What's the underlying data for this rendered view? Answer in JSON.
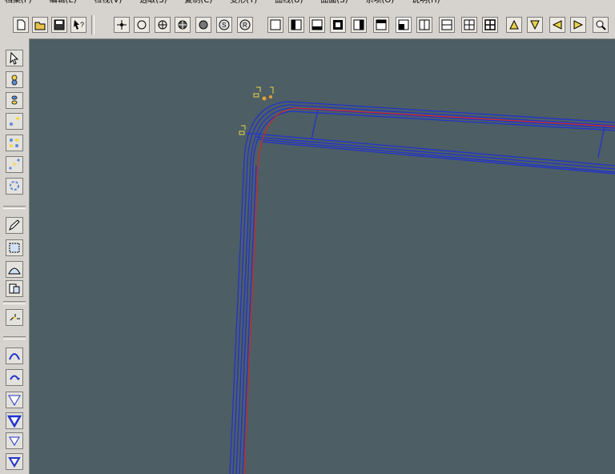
{
  "menu": {
    "items": [
      "档案(F)",
      "编辑(E)",
      "检视(V)",
      "选取(S)",
      "复制(C)",
      "变形(T)",
      "曲线(U)",
      "曲面(S)",
      "系项(O)",
      "说明(H)"
    ]
  },
  "toolbar": {
    "buttons": [
      "new-file-icon",
      "open-folder-icon",
      "save-icon",
      "help-pointer-icon",
      "snap-point-icon",
      "circle-icon",
      "circle-cross-icon",
      "circle-grid-icon",
      "filled-circle-icon",
      "circle-s-icon",
      "circle-r-icon",
      "view-single-icon",
      "view-left-icon",
      "view-bottom-icon",
      "view-frame-icon",
      "view-right-icon",
      "view-top-icon",
      "view-corner-icon",
      "view-split-v-icon",
      "view-split-h-icon",
      "view-grid4-icon",
      "view-grid4b-icon",
      "triangle-up-icon",
      "triangle-down-icon",
      "triangle-left-icon",
      "triangle-right-icon",
      "zoom-icon"
    ]
  },
  "left_toolbar": {
    "buttons": [
      "select-arrow-icon",
      "chain-icon",
      "links-icon",
      "nodes-icon",
      "grid-nodes-icon",
      "dots-diagonal-icon",
      "ring-icon",
      "pencil-icon",
      "box-select-icon",
      "shell-icon",
      "page-icon",
      "sparkle-icon",
      "arch-icon",
      "rotate-icon",
      "funnel-icon",
      "funnel-bold-icon",
      "funnel-small-icon",
      "funnel-down-icon"
    ]
  },
  "colors": {
    "viewport_bg": "#4d5e64",
    "curve_blue": "#2233cc",
    "curve_red": "#dd2222",
    "marker_yellow": "#e8d24a"
  }
}
